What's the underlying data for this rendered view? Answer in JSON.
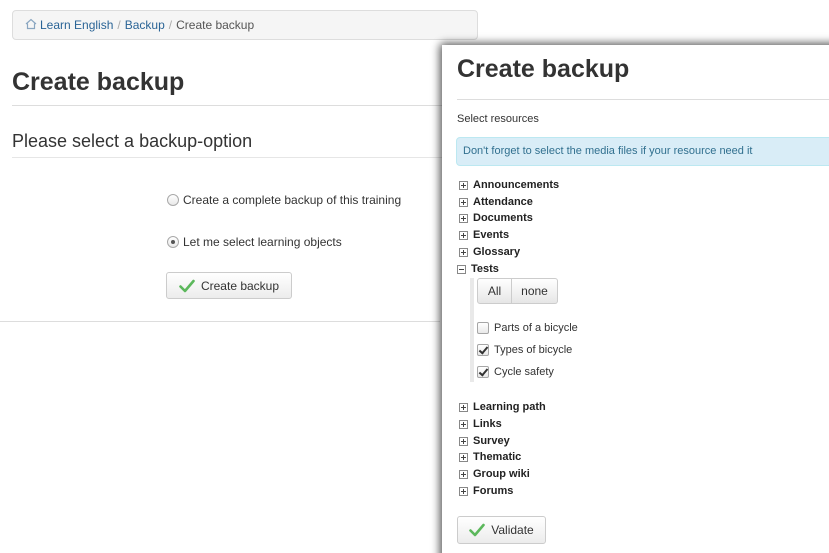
{
  "breadcrumb": {
    "home": "Learn English",
    "section": "Backup",
    "current": "Create backup",
    "separator": "/"
  },
  "background_page": {
    "title": "Create backup",
    "subtitle": "Please select a backup-option",
    "options": [
      {
        "label": "Create a complete backup of this training",
        "selected": false
      },
      {
        "label": "Let me select learning objects",
        "selected": true
      }
    ],
    "submit_label": "Create backup"
  },
  "resource_page": {
    "title": "Create backup",
    "select_label": "Select resources",
    "notice": "Don't forget to select the media files if your resource need it",
    "resources_before": [
      "Announcements",
      "Attendance",
      "Documents",
      "Events",
      "Glossary"
    ],
    "tests_label": "Tests",
    "all_label": "All",
    "none_label": "none",
    "tests": [
      {
        "label": "Parts of a bicycle",
        "checked": false
      },
      {
        "label": "Types of bicycle",
        "checked": true
      },
      {
        "label": "Cycle safety",
        "checked": true
      }
    ],
    "resources_after": [
      "Learning path",
      "Links",
      "Survey",
      "Thematic",
      "Group wiki",
      "Forums"
    ],
    "validate_label": "Validate"
  },
  "colors": {
    "link": "#2a6496",
    "notice_bg": "#d9edf7",
    "notice_text": "#31708f",
    "check_green": "#5cb85c"
  }
}
